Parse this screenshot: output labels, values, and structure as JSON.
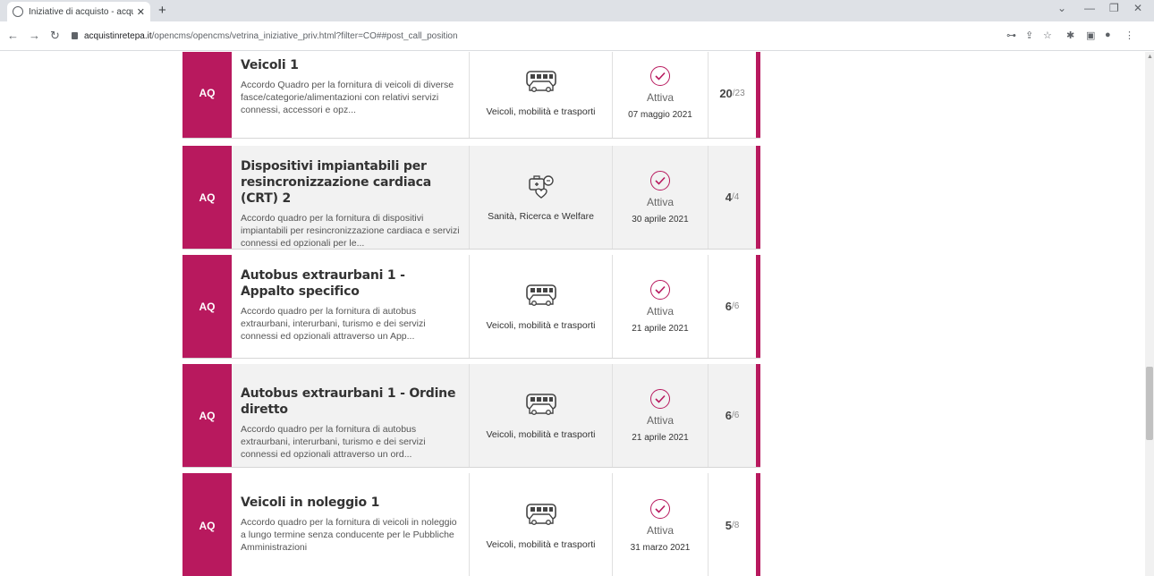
{
  "browser": {
    "tab_title": "Iniziative di acquisto - acquistinr",
    "url_host": "acquistinretepa.it",
    "url_path": "/opencms/opencms/vetrina_iniziative_priv.html?filter=CO##post_call_position"
  },
  "colors": {
    "accent": "#b8195e",
    "shaded_card": "#f2f2f2"
  },
  "cards": [
    {
      "badge": "AQ",
      "title": "Veicoli 1",
      "description": "Accordo Quadro per la fornitura di veicoli di diverse fasce/categorie/alimentazioni con relativi servizi connessi, accessori e opz...",
      "category": "Veicoli, mobilità e trasporti",
      "category_icon": "bus-icon",
      "status": "Attiva",
      "date": "07 maggio 2021",
      "count_current": "20",
      "count_total": "/23"
    },
    {
      "badge": "AQ",
      "title": "Dispositivi impiantabili per resincronizzazione cardiaca (CRT) 2",
      "description": "Accordo quadro per la fornitura di dispositivi impiantabili per resincronizzazione cardiaca e servizi connessi ed opzionali per le...",
      "category": "Sanità, Ricerca e Welfare",
      "category_icon": "health-care-icon",
      "status": "Attiva",
      "date": "30 aprile 2021",
      "count_current": "4",
      "count_total": "/4"
    },
    {
      "badge": "AQ",
      "title": "Autobus extraurbani 1 - Appalto specifico",
      "description": "Accordo quadro per la fornitura di autobus extraurbani, interurbani, turismo e dei servizi connessi ed opzionali attraverso un App...",
      "category": "Veicoli, mobilità e trasporti",
      "category_icon": "bus-icon",
      "status": "Attiva",
      "date": "21 aprile 2021",
      "count_current": "6",
      "count_total": "/6"
    },
    {
      "badge": "AQ",
      "title": "Autobus extraurbani 1 - Ordine diretto",
      "description": "Accordo quadro per la fornitura di autobus extraurbani, interurbani, turismo e dei servizi connessi ed opzionali attraverso un ord...",
      "category": "Veicoli, mobilità e trasporti",
      "category_icon": "bus-icon",
      "status": "Attiva",
      "date": "21 aprile 2021",
      "count_current": "6",
      "count_total": "/6"
    },
    {
      "badge": "AQ",
      "title": "Veicoli in noleggio 1",
      "description": "Accordo quadro per la fornitura di veicoli in noleggio a lungo termine senza conducente per le Pubbliche Amministrazioni",
      "category": "Veicoli, mobilità e trasporti",
      "category_icon": "bus-icon",
      "status": "Attiva",
      "date": "31 marzo 2021",
      "count_current": "5",
      "count_total": "/8"
    }
  ]
}
